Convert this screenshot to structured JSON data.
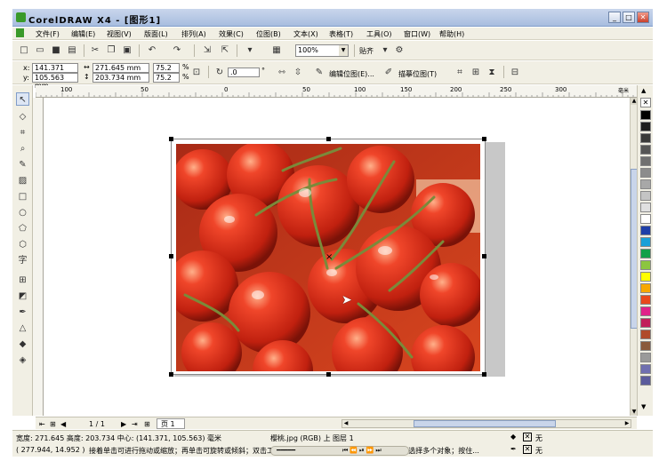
{
  "window": {
    "title": "CorelDRAW X4 - [图形1]",
    "min": "_",
    "max": "□",
    "close": "✕"
  },
  "menu": [
    "文件(F)",
    "编辑(E)",
    "视图(V)",
    "版面(L)",
    "排列(A)",
    "效果(C)",
    "位图(B)",
    "文本(X)",
    "表格(T)",
    "工具(O)",
    "窗口(W)",
    "帮助(H)"
  ],
  "toolbar": {
    "zoom": "100%",
    "snap": "贴齐"
  },
  "props": {
    "x": "141.371 mm",
    "y": "105.563 mm",
    "w": "271.645 mm",
    "h": "203.734 mm",
    "sx": "75.2",
    "sy": "75.2",
    "angle": ".0",
    "edit_bitmap": "编辑位图(E)...",
    "trace_bitmap": "描摹位图(T)"
  },
  "ruler_top": [
    "100",
    "50",
    "0",
    "50",
    "100",
    "150",
    "200",
    "250",
    "300"
  ],
  "ruler_units": "毫米",
  "page": {
    "counter": "1 / 1",
    "tab": "页 1"
  },
  "status": {
    "line1": "宽度: 271.645  高度: 203.734  中心: (141.371, 105.563)  毫米",
    "object": "樱桃.jpg (RGB) 上 图层 1",
    "coords": "( 277.944, 14.952 )",
    "hint": "接着单击可进行拖动或缩放；再单击可旋转或倾斜；双击工具，可选择所有对象；按住 Shift 键单击可选择多个对象；按住...",
    "fill": "无",
    "outline": "无"
  },
  "colors": {
    "palette": [
      "#000000",
      "#1e1e1e",
      "#3a3a3a",
      "#555555",
      "#707070",
      "#8c8c8c",
      "#a8a8a8",
      "#c4c4c4",
      "#e0e0e0",
      "#ffffff",
      "#1f3fa8",
      "#1aa0d8",
      "#11a048",
      "#8cc63f",
      "#ffff00",
      "#f7a800",
      "#e8491d",
      "#e0218a",
      "#c11f5a",
      "#b04a2a",
      "#8a5a3c",
      "#9a9a9a",
      "#6f6fb0",
      "#5b5b9c"
    ]
  }
}
